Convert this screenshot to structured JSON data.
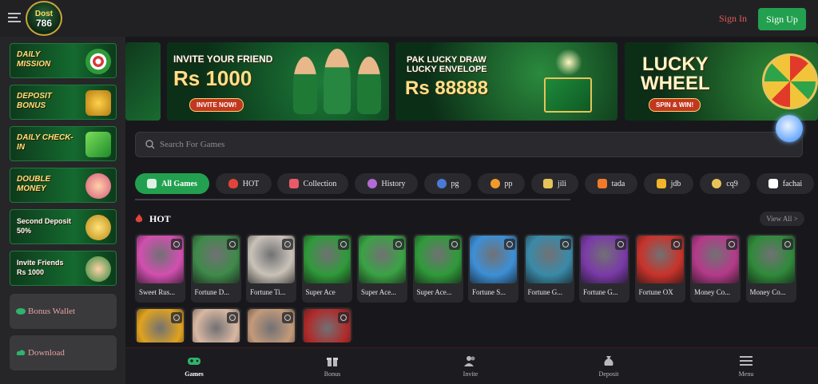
{
  "header": {
    "logo_top": "Dost",
    "logo_bottom": "786",
    "sign_in": "Sign In",
    "sign_up": "Sign Up"
  },
  "sidebar": {
    "promos": [
      {
        "label": "DAILY MISSION"
      },
      {
        "label": "DEPOSIT BONUS"
      },
      {
        "label": "DAILY CHECK-IN"
      },
      {
        "label": "DOUBLE MONEY"
      },
      {
        "label": "Second Deposit 50%"
      },
      {
        "label": "Invite Friends Rs 1000"
      }
    ],
    "bonus_wallet": "Bonus Wallet",
    "download": "Download"
  },
  "banners": {
    "invite_title": "INVITE YOUR FRIEND",
    "invite_amount": "Rs 1000",
    "invite_button": "INVITE NOW!",
    "draw_title_1": "PAK LUCKY DRAW",
    "draw_title_2": "LUCKY ENVELOPE",
    "draw_amount": "Rs 88888",
    "wheel_title_1": "LUCKY",
    "wheel_title_2": "WHEEL",
    "wheel_button": "SPIN & WIN!"
  },
  "search": {
    "placeholder": "Search For Games"
  },
  "tabs": [
    {
      "label": "All Games",
      "active": true
    },
    {
      "label": "HOT"
    },
    {
      "label": "Collection"
    },
    {
      "label": "History"
    },
    {
      "label": "pg"
    },
    {
      "label": "pp"
    },
    {
      "label": "jili"
    },
    {
      "label": "tada"
    },
    {
      "label": "jdb"
    },
    {
      "label": "cq9"
    },
    {
      "label": "fachai"
    }
  ],
  "section": {
    "title": "HOT",
    "view_all": "View All >"
  },
  "games": [
    {
      "name": "Sweet Rus...",
      "color": "#d24fb0"
    },
    {
      "name": "Fortune D...",
      "color": "#3f8a4a"
    },
    {
      "name": "Fortune Ti...",
      "color": "#c9c2b8"
    },
    {
      "name": "Super Ace",
      "color": "#2f9a3a"
    },
    {
      "name": "Super Ace...",
      "color": "#3aa344"
    },
    {
      "name": "Super Ace...",
      "color": "#2f9a3a"
    },
    {
      "name": "Fortune S...",
      "color": "#3d8fd6"
    },
    {
      "name": "Fortune G...",
      "color": "#3a8aa8"
    },
    {
      "name": "Fortune G...",
      "color": "#7a3aa8"
    },
    {
      "name": "Fortune OX",
      "color": "#c8332b"
    },
    {
      "name": "Money Co...",
      "color": "#b43a8a"
    },
    {
      "name": "Money Co...",
      "color": "#2f8a3a"
    },
    {
      "name": "",
      "color": "#e0a21f"
    },
    {
      "name": "",
      "color": "#d9b8a2"
    },
    {
      "name": "",
      "color": "#c49a7a"
    },
    {
      "name": "",
      "color": "#b02a2a"
    }
  ],
  "bottom_nav": [
    {
      "label": "Games",
      "icon": "gamepad-icon",
      "active": true
    },
    {
      "label": "Bonus",
      "icon": "gift-icon"
    },
    {
      "label": "Invite",
      "icon": "users-icon"
    },
    {
      "label": "Deposit",
      "icon": "money-bag-icon"
    },
    {
      "label": "Menu",
      "icon": "menu-icon"
    }
  ]
}
